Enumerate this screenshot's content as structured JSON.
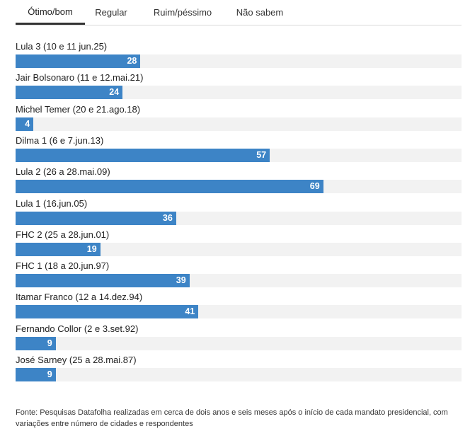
{
  "tabs": [
    {
      "label": "Ótimo/bom",
      "active": true
    },
    {
      "label": "Regular",
      "active": false
    },
    {
      "label": "Ruim/péssimo",
      "active": false
    },
    {
      "label": "Não sabem",
      "active": false
    }
  ],
  "chart_data": {
    "type": "bar",
    "orientation": "horizontal",
    "categories": [
      "Lula 3 (10 e 11 jun.25)",
      "Jair Bolsonaro (11 e 12.mai.21)",
      "Michel Temer (20 e 21.ago.18)",
      "Dilma 1 (6 e 7.jun.13)",
      "Lula 2 (26 a 28.mai.09)",
      "Lula 1 (16.jun.05)",
      "FHC 2 (25 a 28.jun.01)",
      "FHC 1 (18 a 20.jun.97)",
      "Itamar Franco (12 a 14.dez.94)",
      "Fernando Collor (2 e 3.set.92)",
      "José Sarney (25 a 28.mai.87)"
    ],
    "values": [
      28,
      24,
      4,
      57,
      69,
      36,
      19,
      39,
      41,
      9,
      9
    ],
    "xlim": [
      0,
      100
    ],
    "bar_color": "#3d84c6",
    "track_color": "#f2f2f2",
    "value_label_color": "#ffffff",
    "grid": false,
    "legend": false
  },
  "footnote": "Fonte: Pesquisas Datafolha realizadas em cerca de dois anos e seis meses após o início de cada mandato presidencial, com variações entre número de cidades e respondentes"
}
